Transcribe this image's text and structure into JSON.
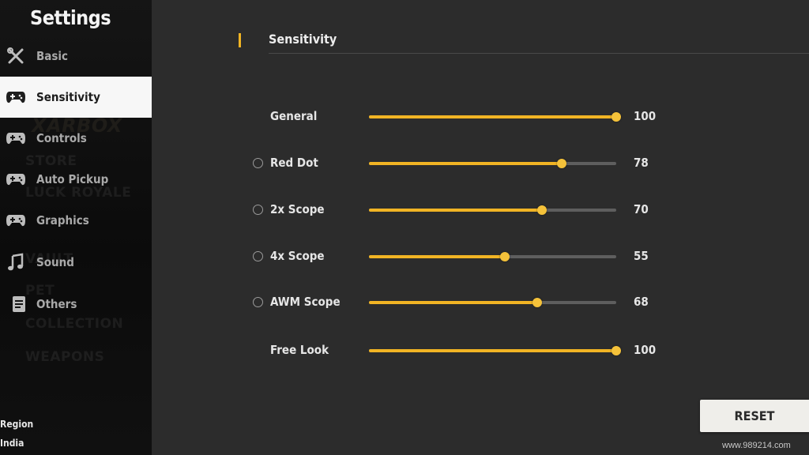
{
  "sidebar": {
    "title": "Settings",
    "items": [
      {
        "label": "Basic",
        "icon": "tools-icon",
        "active": false
      },
      {
        "label": "Sensitivity",
        "icon": "gamepad-icon",
        "active": true
      },
      {
        "label": "Controls",
        "icon": "gamepad-icon",
        "active": false
      },
      {
        "label": "Auto Pickup",
        "icon": "gamepad-icon",
        "active": false
      },
      {
        "label": "Graphics",
        "icon": "gamepad-icon",
        "active": false
      },
      {
        "label": "Sound",
        "icon": "music-note-icon",
        "active": false
      },
      {
        "label": "Others",
        "icon": "document-icon",
        "active": false
      }
    ],
    "background_text": [
      "STORE",
      "LUCK ROYALE",
      "VAULT",
      "PET",
      "COLLECTION",
      "WEAPONS"
    ],
    "region_label": "Region",
    "region_value": "India"
  },
  "main": {
    "section_title": "Sensitivity",
    "sliders": [
      {
        "label": "General",
        "value": "100",
        "percent": 1.0,
        "icon": ""
      },
      {
        "label": "Red Dot",
        "value": "78",
        "percent": 0.78,
        "icon": "red-dot-icon"
      },
      {
        "label": "2x Scope",
        "value": "70",
        "percent": 0.7,
        "icon": "scope-2x-icon"
      },
      {
        "label": "4x Scope",
        "value": "55",
        "percent": 0.55,
        "icon": "scope-4x-icon"
      },
      {
        "label": "AWM Scope",
        "value": "68",
        "percent": 0.68,
        "icon": "awm-scope-icon"
      },
      {
        "label": "Free Look",
        "value": "100",
        "percent": 1.0,
        "icon": ""
      }
    ],
    "reset_label": "RESET"
  },
  "watermark": "www.989214.com",
  "colors": {
    "accent": "#f1b424",
    "track": "#5e5e5e",
    "active_tab": "#f7f7f7"
  }
}
